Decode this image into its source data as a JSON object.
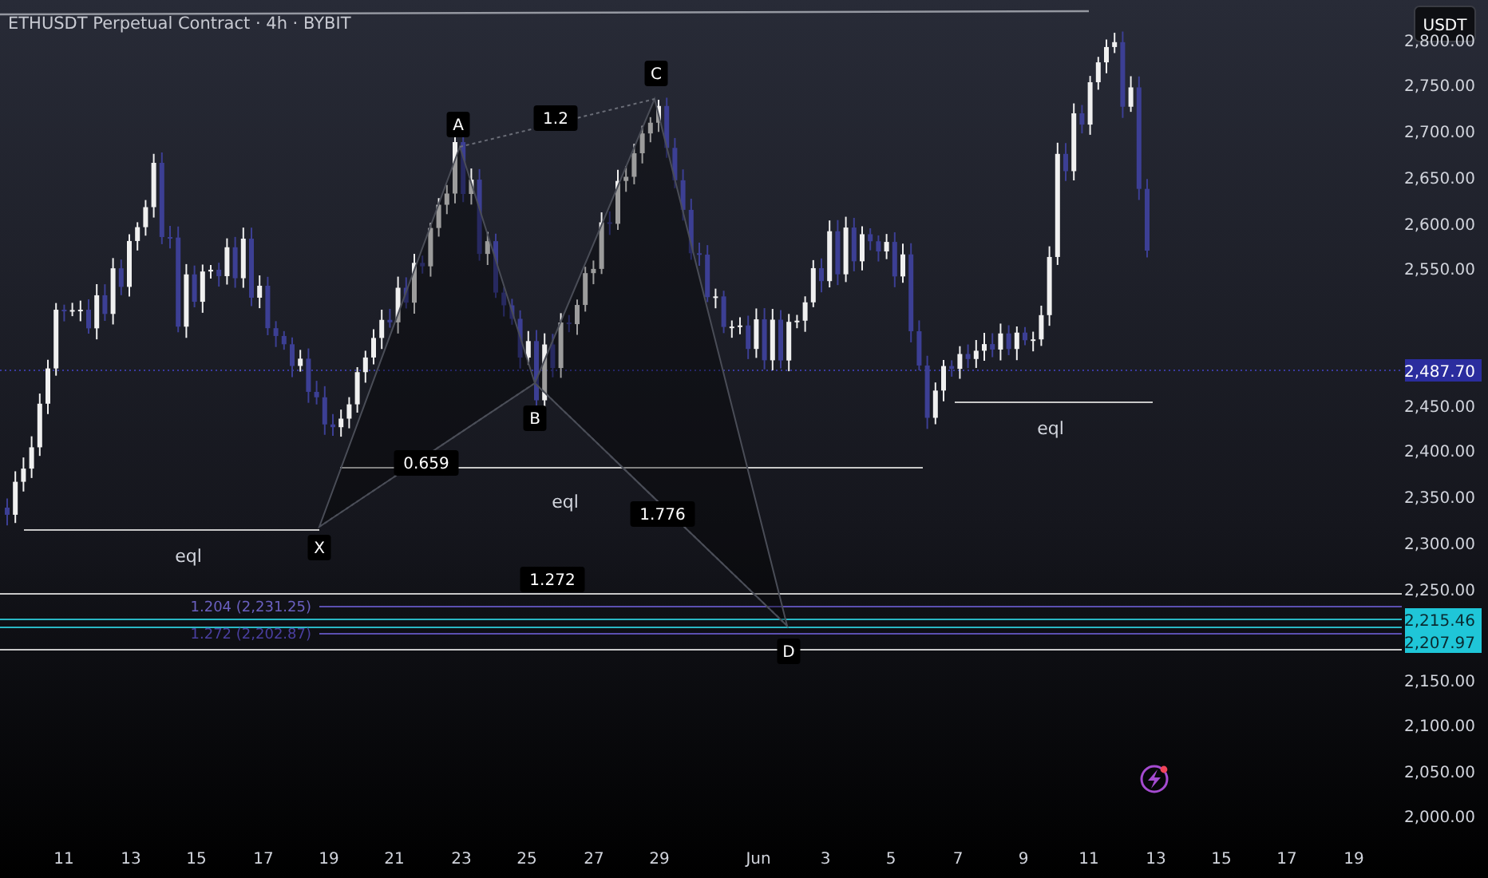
{
  "header": {
    "title": "ETHUSDT Perpetual Contract · 4h · BYBIT"
  },
  "currency_button": {
    "label": "USDT"
  },
  "price_axis": {
    "labels": [
      "2,800.00",
      "2,750.00",
      "2,700.00",
      "2,650.00",
      "2,600.00",
      "2,550.00",
      "2,450.00",
      "2,400.00",
      "2,350.00",
      "2,300.00",
      "2,250.00",
      "2,150.00",
      "2,100.00",
      "2,050.00",
      "2,000.00"
    ]
  },
  "price_tags": [
    {
      "text": "2,487.70",
      "color": "#2b2d9e"
    },
    {
      "text": "2,215.46",
      "color": "#1fc6d8"
    },
    {
      "text": "2,207.97",
      "color": "#1fc6d8"
    }
  ],
  "time_axis": {
    "labels": [
      "11",
      "13",
      "15",
      "17",
      "19",
      "21",
      "23",
      "25",
      "27",
      "29",
      "Jun",
      "3",
      "5",
      "7",
      "9",
      "11",
      "13",
      "15",
      "17",
      "19"
    ]
  },
  "pattern": {
    "points": [
      "X",
      "A",
      "B",
      "C",
      "D"
    ],
    "ratios": [
      "1.2",
      "0.659",
      "1.776",
      "1.272"
    ]
  },
  "level_labels": [
    "eql",
    "eql",
    "eql"
  ],
  "fib_labels": [
    {
      "text": "1.204 (2,231.25)"
    },
    {
      "text": "1.272 (2,202.87)"
    }
  ]
}
